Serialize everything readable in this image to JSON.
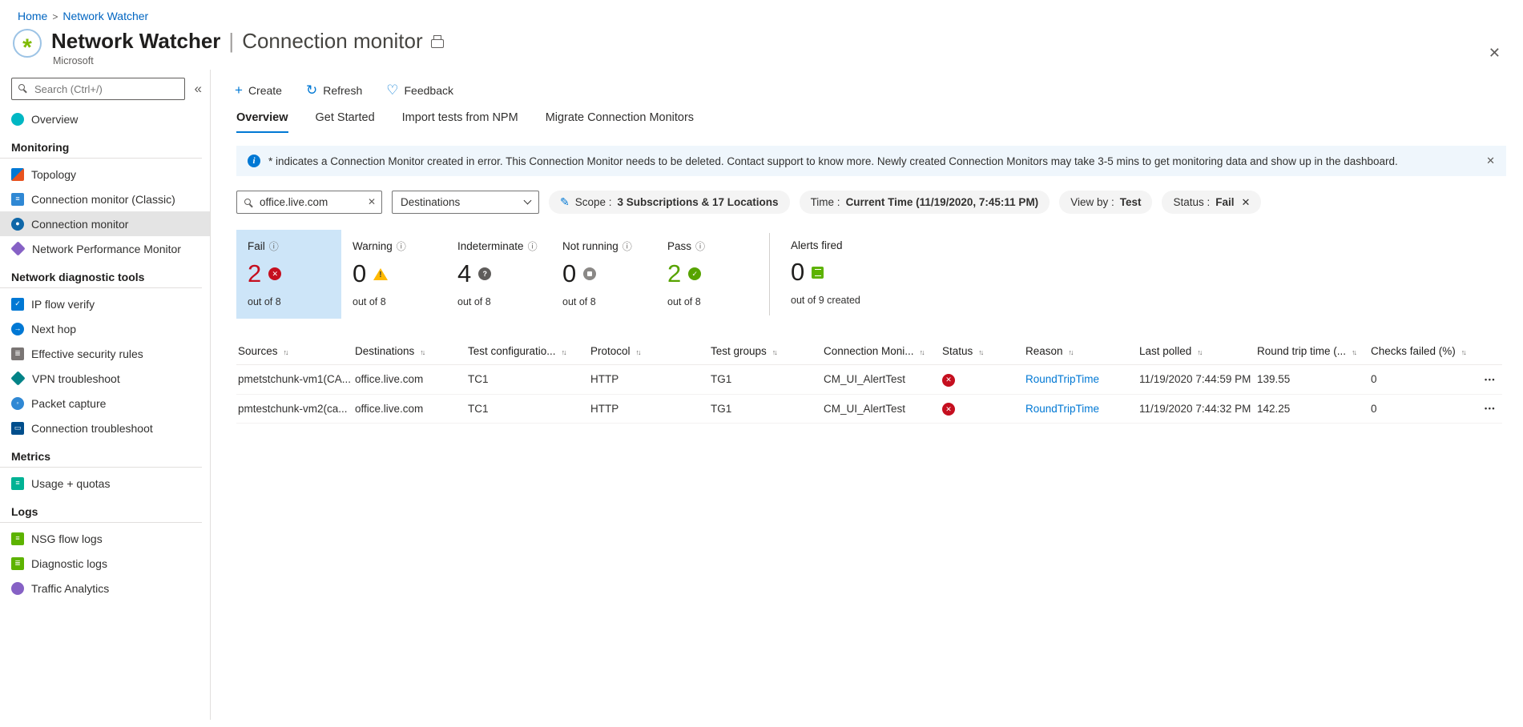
{
  "colors": {
    "brand_blue": "#0078d4",
    "fail_red": "#c50f1f",
    "pass_green": "#57a300",
    "warning_yellow": "#ffb900",
    "selected_card_bg": "#cde5f8"
  },
  "icons": {
    "info": "ⓘ",
    "sort": "↑↓",
    "menu": "•••",
    "collapse": "«",
    "close": "✕",
    "heart": "♡",
    "refresh": "↻",
    "plus": "+",
    "pencil": "✎",
    "clear": "✕",
    "logo_star": "*"
  },
  "breadcrumb": {
    "home": "Home",
    "sep": ">",
    "current": "Network Watcher"
  },
  "header": {
    "title": "Network Watcher",
    "pipe": "|",
    "subtitle": "Connection monitor",
    "publisher": "Microsoft"
  },
  "sidebar": {
    "search_placeholder": "Search (Ctrl+/)",
    "overview": "Overview",
    "selected_item": "Connection monitor",
    "sections": [
      {
        "title": "Monitoring",
        "items": [
          "Topology",
          "Connection monitor (Classic)",
          "Connection monitor",
          "Network Performance Monitor"
        ]
      },
      {
        "title": "Network diagnostic tools",
        "items": [
          "IP flow verify",
          "Next hop",
          "Effective security rules",
          "VPN troubleshoot",
          "Packet capture",
          "Connection troubleshoot"
        ]
      },
      {
        "title": "Metrics",
        "items": [
          "Usage + quotas"
        ]
      },
      {
        "title": "Logs",
        "items": [
          "NSG flow logs",
          "Diagnostic logs",
          "Traffic Analytics"
        ]
      }
    ]
  },
  "commandbar": {
    "create": "Create",
    "refresh": "Refresh",
    "feedback": "Feedback"
  },
  "tabs": {
    "items": [
      "Overview",
      "Get Started",
      "Import tests from NPM",
      "Migrate Connection Monitors"
    ],
    "active": "Overview"
  },
  "banner": {
    "text": "* indicates a Connection Monitor created in error. This Connection Monitor needs to be deleted. Contact support to know more. Newly created Connection Monitors may take 3-5 mins to get monitoring data and show up in the dashboard."
  },
  "filters": {
    "search_value": "office.live.com",
    "dropdown_value": "Destinations",
    "scope_label": "Scope :",
    "scope_value": "3 Subscriptions & 17 Locations",
    "time_label": "Time :",
    "time_value": "Current Time (11/19/2020, 7:45:11 PM)",
    "viewby_label": "View by :",
    "viewby_value": "Test",
    "status_label": "Status :",
    "status_value": "Fail"
  },
  "stats": {
    "cards": [
      {
        "label": "Fail",
        "value": "2",
        "sub": "out of 8",
        "state": "fail",
        "active": true
      },
      {
        "label": "Warning",
        "value": "0",
        "sub": "out of 8",
        "state": "warning",
        "active": false
      },
      {
        "label": "Indeterminate",
        "value": "4",
        "sub": "out of 8",
        "state": "indeterminate",
        "active": false
      },
      {
        "label": "Not running",
        "value": "0",
        "sub": "out of 8",
        "state": "not-running",
        "active": false
      },
      {
        "label": "Pass",
        "value": "2",
        "sub": "out of 8",
        "state": "pass",
        "active": false
      }
    ],
    "alerts": {
      "label": "Alerts fired",
      "value": "0",
      "sub": "out of 9 created"
    }
  },
  "table": {
    "columns": [
      "Sources",
      "Destinations",
      "Test configuratio...",
      "Protocol",
      "Test groups",
      "Connection Moni...",
      "Status",
      "Reason",
      "Last polled",
      "Round trip time (...",
      "Checks failed (%)"
    ],
    "rows": [
      {
        "sources": "pmetstchunk-vm1(CA...",
        "destinations": "office.live.com",
        "test_config": "TC1",
        "protocol": "HTTP",
        "test_groups": "TG1",
        "connection_monitor": "CM_UI_AlertTest",
        "status": "Fail",
        "reason": "RoundTripTime",
        "last_polled": "11/19/2020 7:44:59 PM",
        "round_trip_time": "139.55",
        "checks_failed": "0"
      },
      {
        "sources": "pmtestchunk-vm2(ca...",
        "destinations": "office.live.com",
        "test_config": "TC1",
        "protocol": "HTTP",
        "test_groups": "TG1",
        "connection_monitor": "CM_UI_AlertTest",
        "status": "Fail",
        "reason": "RoundTripTime",
        "last_polled": "11/19/2020 7:44:32 PM",
        "round_trip_time": "142.25",
        "checks_failed": "0"
      }
    ]
  }
}
